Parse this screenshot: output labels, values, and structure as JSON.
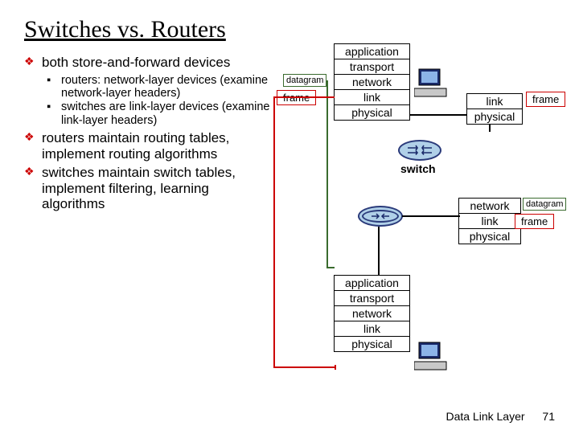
{
  "title": "Switches vs. Routers",
  "bullets": {
    "b1": "both store-and-forward devices",
    "b1s1": "routers: network-layer devices (examine network-layer headers)",
    "b1s2": "switches are link-layer devices (examine link-layer headers)",
    "b2": "routers maintain routing tables, implement routing algorithms",
    "b3": "switches maintain switch tables, implement filtering, learning algorithms"
  },
  "stack_top": {
    "l1": "application",
    "l2": "transport",
    "l3": "network",
    "l4": "link",
    "l5": "physical"
  },
  "stack_switch": {
    "l1": "link",
    "l2": "physical"
  },
  "stack_router": {
    "l1": "network",
    "l2": "link",
    "l3": "physical"
  },
  "stack_bottom": {
    "l1": "application",
    "l2": "transport",
    "l3": "network",
    "l4": "link",
    "l5": "physical"
  },
  "labels": {
    "frame": "frame",
    "datagram": "datagram",
    "switch": "switch"
  },
  "footer": {
    "text": "Data Link Layer",
    "page": "71"
  }
}
